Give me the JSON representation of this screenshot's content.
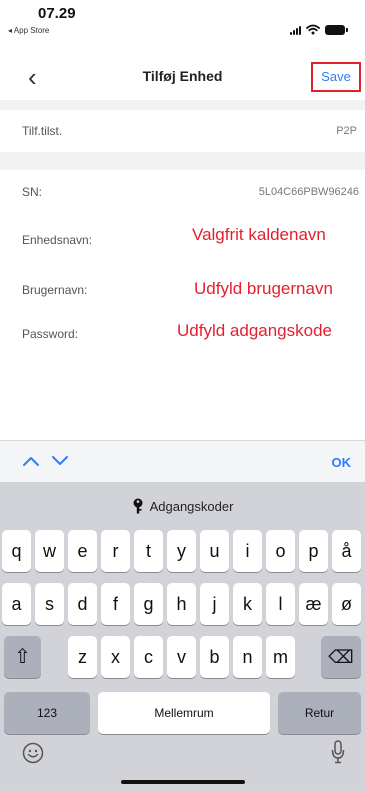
{
  "status_bar": {
    "time": "07.29",
    "back_app": "◂ App Store"
  },
  "nav": {
    "back_glyph": "‹",
    "title": "Tilføj Enhed",
    "save_label": "Save"
  },
  "device_type": {
    "label": "Tilf.tilst.",
    "value": "P2P"
  },
  "fields": {
    "sn": {
      "label": "SN:",
      "value": "5L04C66PBW96246"
    },
    "device_name": {
      "label": "Enhedsnavn:",
      "annotation": "Valgfrit kaldenavn"
    },
    "username": {
      "label": "Brugernavn:",
      "annotation": "Udfyld brugernavn"
    },
    "password": {
      "label": "Password:",
      "annotation": "Udfyld adgangskode"
    }
  },
  "accessory": {
    "ok_label": "OK"
  },
  "keyboard": {
    "suggestion": "Adgangskoder",
    "row1": [
      "q",
      "w",
      "e",
      "r",
      "t",
      "y",
      "u",
      "i",
      "o",
      "p",
      "å"
    ],
    "row2": [
      "a",
      "s",
      "d",
      "f",
      "g",
      "h",
      "j",
      "k",
      "l",
      "æ",
      "ø"
    ],
    "row3": [
      "z",
      "x",
      "c",
      "v",
      "b",
      "n",
      "m"
    ],
    "numbers_label": "123",
    "space_label": "Mellemrum",
    "return_label": "Retur",
    "shift_glyph": "⇧",
    "delete_glyph": "⌫"
  },
  "colors": {
    "accent": "#2f7ef5",
    "annotation_red": "#e5202e",
    "keyboard_bg": "#d1d3d9"
  }
}
